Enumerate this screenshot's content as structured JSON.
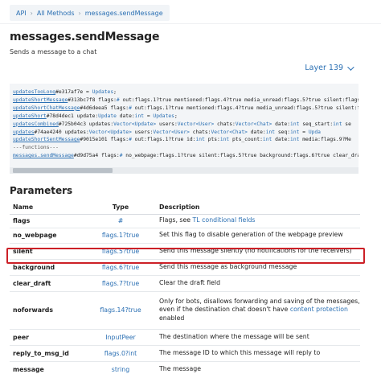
{
  "breadcrumb": {
    "items": [
      "API",
      "All Methods",
      "messages.sendMessage"
    ],
    "separator": "›"
  },
  "page": {
    "title": "messages.sendMessage",
    "subtitle": "Sends a message to a chat"
  },
  "layer_selector": {
    "label": "Layer 139"
  },
  "code": {
    "lines": [
      [
        {
          "t": "updatesTooLong",
          "c": "fn"
        },
        {
          "t": "#e317af7e = ",
          "c": ""
        },
        {
          "t": "Updates",
          "c": "ty"
        },
        {
          "t": ";",
          "c": ""
        }
      ],
      [
        {
          "t": "updateShortMessage",
          "c": "fn"
        },
        {
          "t": "#313bc7f8 flags:",
          "c": ""
        },
        {
          "t": "#",
          "c": "ty"
        },
        {
          "t": " out:flags.1?true mentioned:flags.4?true media_unread:flags.5?true silent:flags",
          "c": ""
        }
      ],
      [
        {
          "t": "updateShortChatMessage",
          "c": "fn"
        },
        {
          "t": "#4d6deea5 flags:",
          "c": ""
        },
        {
          "t": "#",
          "c": "ty"
        },
        {
          "t": " out:flags.1?true mentioned:flags.4?true media_unread:flags.5?true silent:fl",
          "c": ""
        }
      ],
      [
        {
          "t": "updateShort",
          "c": "fn"
        },
        {
          "t": "#78d4dec1 update:",
          "c": ""
        },
        {
          "t": "Update",
          "c": "ty"
        },
        {
          "t": " date:",
          "c": ""
        },
        {
          "t": "int",
          "c": "ty"
        },
        {
          "t": " = ",
          "c": ""
        },
        {
          "t": "Updates",
          "c": "ty"
        },
        {
          "t": ";",
          "c": ""
        }
      ],
      [
        {
          "t": "updatesCombined",
          "c": "fn"
        },
        {
          "t": "#725b04c3 updates:",
          "c": ""
        },
        {
          "t": "Vector<Update>",
          "c": "ty"
        },
        {
          "t": " users:",
          "c": ""
        },
        {
          "t": "Vector<User>",
          "c": "ty"
        },
        {
          "t": " chats:",
          "c": ""
        },
        {
          "t": "Vector<Chat>",
          "c": "ty"
        },
        {
          "t": " date:",
          "c": ""
        },
        {
          "t": "int",
          "c": "ty"
        },
        {
          "t": " seq_start:",
          "c": ""
        },
        {
          "t": "int",
          "c": "ty"
        },
        {
          "t": " se",
          "c": ""
        }
      ],
      [
        {
          "t": "updates",
          "c": "fn"
        },
        {
          "t": "#74ae4240 updates:",
          "c": ""
        },
        {
          "t": "Vector<Update>",
          "c": "ty"
        },
        {
          "t": " users:",
          "c": ""
        },
        {
          "t": "Vector<User>",
          "c": "ty"
        },
        {
          "t": " chats:",
          "c": ""
        },
        {
          "t": "Vector<Chat>",
          "c": "ty"
        },
        {
          "t": " date:",
          "c": ""
        },
        {
          "t": "int",
          "c": "ty"
        },
        {
          "t": " seq:",
          "c": ""
        },
        {
          "t": "int",
          "c": "ty"
        },
        {
          "t": " = ",
          "c": ""
        },
        {
          "t": "Upda",
          "c": "ty"
        }
      ],
      [
        {
          "t": "updateShortSentMessage",
          "c": "fn"
        },
        {
          "t": "#9015e101 flags:",
          "c": ""
        },
        {
          "t": "#",
          "c": "ty"
        },
        {
          "t": " out:flags.1?true id:",
          "c": ""
        },
        {
          "t": "int",
          "c": "ty"
        },
        {
          "t": " pts:",
          "c": ""
        },
        {
          "t": "int",
          "c": "ty"
        },
        {
          "t": " pts_count:",
          "c": ""
        },
        {
          "t": "int",
          "c": "ty"
        },
        {
          "t": " date:",
          "c": ""
        },
        {
          "t": "int",
          "c": "ty"
        },
        {
          "t": " media:flags.9?Me",
          "c": ""
        }
      ],
      [
        {
          "t": "---functions---",
          "c": "cm"
        }
      ],
      [
        {
          "t": "messages.sendMessage",
          "c": "fn"
        },
        {
          "t": "#d9d75a4 flags:",
          "c": ""
        },
        {
          "t": "#",
          "c": "ty"
        },
        {
          "t": " no_webpage:flags.1?true silent:flags.5?true background:flags.6?true clear_dra",
          "c": ""
        }
      ]
    ]
  },
  "parameters": {
    "heading": "Parameters",
    "columns": [
      "Name",
      "Type",
      "Description"
    ],
    "rows": [
      {
        "name": "flags",
        "type": "#",
        "desc": "Flags, see ",
        "desc_link": "TL conditional fields",
        "desc_after": ""
      },
      {
        "name": "no_webpage",
        "type": "flags.1?true",
        "desc": "Set this flag to disable generation of the webpage preview",
        "desc_link": "",
        "desc_after": ""
      },
      {
        "name": "silent",
        "type": "flags.5?true",
        "desc": "Send this message silently (no notifications for the receivers)",
        "desc_link": "",
        "desc_after": ""
      },
      {
        "name": "background",
        "type": "flags.6?true",
        "desc": "Send this message as background message",
        "desc_link": "",
        "desc_after": ""
      },
      {
        "name": "clear_draft",
        "type": "flags.7?true",
        "desc": "Clear the draft field",
        "desc_link": "",
        "desc_after": ""
      },
      {
        "name": "noforwards",
        "type": "flags.14?true",
        "desc": "Only for bots, disallows forwarding and saving of the messages, even if the destination chat doesn't have ",
        "desc_link": "content protection",
        "desc_after": " enabled"
      },
      {
        "name": "peer",
        "type": "InputPeer",
        "desc": "The destination where the message will be sent",
        "desc_link": "",
        "desc_after": ""
      },
      {
        "name": "reply_to_msg_id",
        "type": "flags.0?int",
        "desc": "The message ID to which this message will reply to",
        "desc_link": "",
        "desc_after": ""
      },
      {
        "name": "message",
        "type": "string",
        "desc": "The message",
        "desc_link": "",
        "desc_after": ""
      }
    ]
  },
  "highlight": {
    "row_name": "silent",
    "color": "#cc2027"
  },
  "colors": {
    "link": "#2a6fb3",
    "code_bg": "#f3f5f7",
    "breadcrumb_bg": "#f1f4f7"
  }
}
